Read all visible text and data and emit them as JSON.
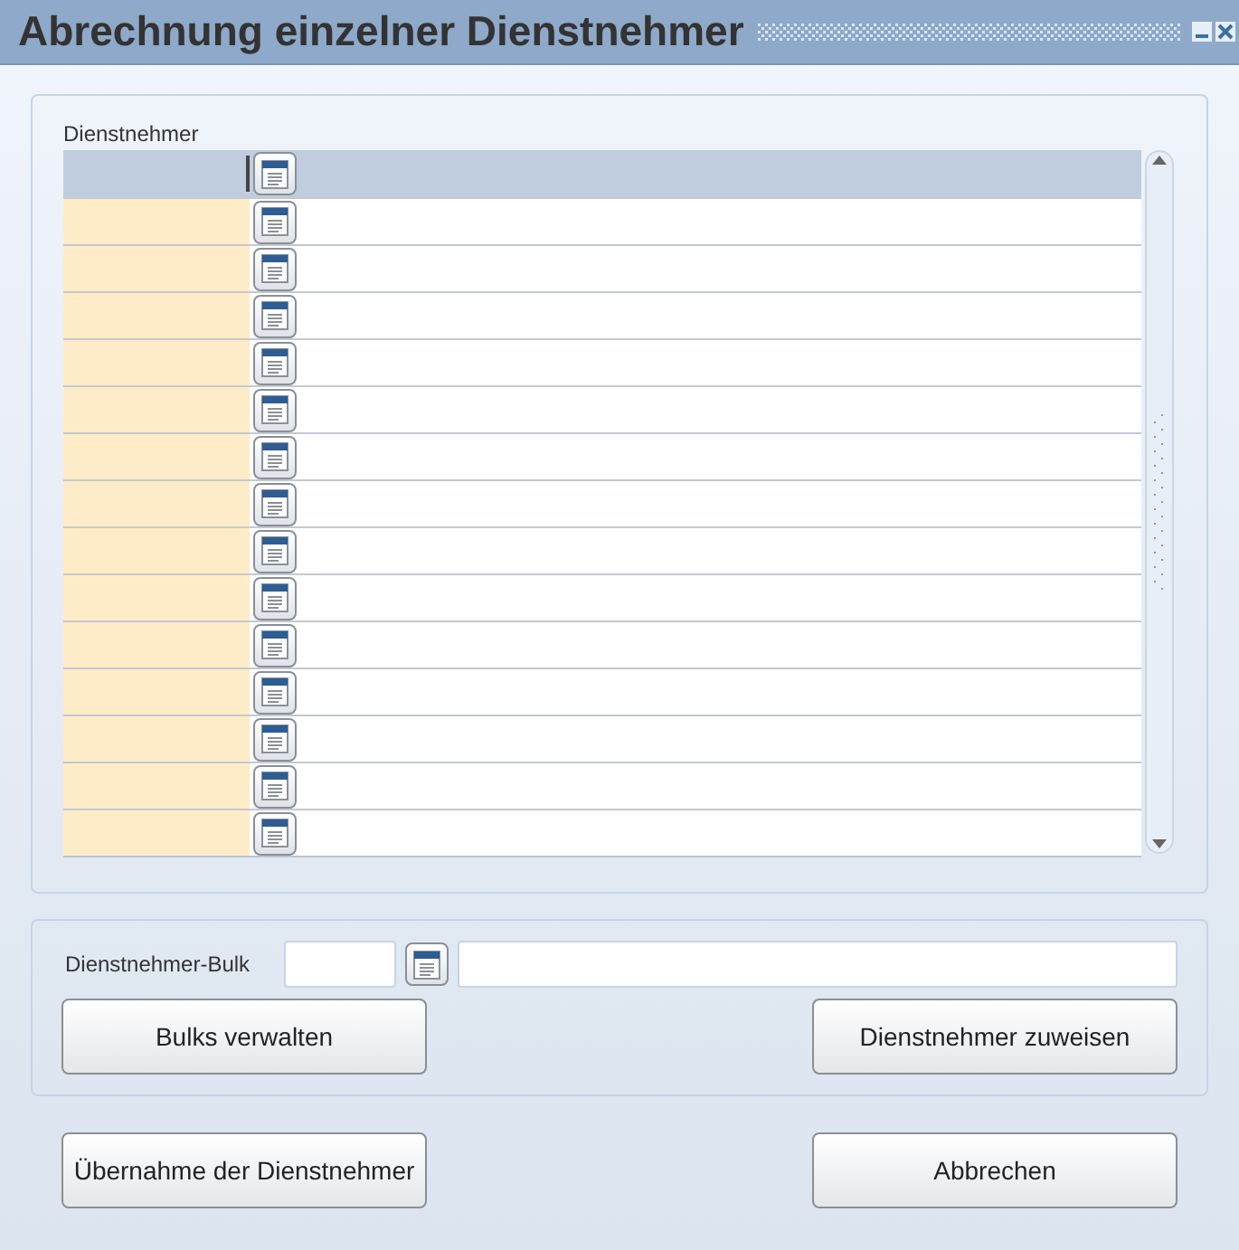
{
  "window": {
    "title": "Abrechnung einzelner Dienstnehmer"
  },
  "employees": {
    "label": "Dienstnehmer",
    "rows": [
      {
        "kind": "lookup"
      },
      {
        "kind": "lookup"
      },
      {
        "kind": "lookup"
      },
      {
        "kind": "lookup"
      },
      {
        "kind": "lookup"
      },
      {
        "kind": "lookup"
      },
      {
        "kind": "lookup"
      },
      {
        "kind": "lookup"
      },
      {
        "kind": "lookup"
      },
      {
        "kind": "lookup"
      },
      {
        "kind": "lookup"
      },
      {
        "kind": "lookup"
      },
      {
        "kind": "lookup"
      },
      {
        "kind": "lookup"
      }
    ]
  },
  "bulk": {
    "label": "Dienstnehmer-Bulk",
    "buttons": [
      "Bulks verwalten",
      "Dienstnehmer zuweisen"
    ]
  },
  "buttons": [
    "Übernahme der Dienstnehmer",
    "Abbrechen"
  ]
}
